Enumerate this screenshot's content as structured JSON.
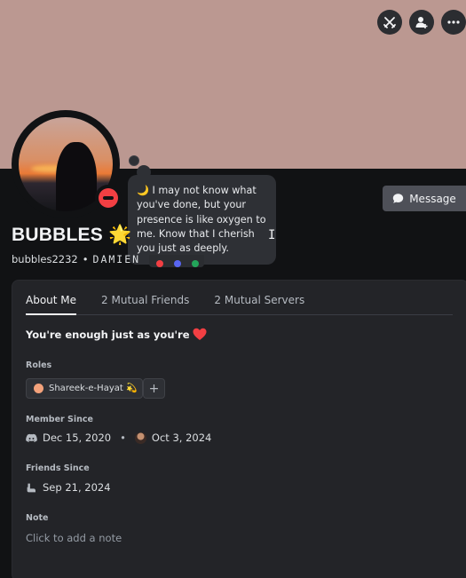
{
  "colors": {
    "banner": "#bb9891",
    "status_dnd": "#f23f43",
    "heart": "#f23f43",
    "role_dot": "#f3a27b"
  },
  "top_actions": {
    "icons": [
      "crossed-swords-icon",
      "person-add-icon",
      "more-options-icon"
    ]
  },
  "status": {
    "icon": "do-not-disturb-icon",
    "custom_status_emoji": "🌙",
    "custom_status_text": "I may not know what you've done, but your presence is like oxygen to me. Know that I cherish you just as deeply."
  },
  "profile": {
    "display_name": "BUBBLES 🌟",
    "username": "bubbles2232",
    "separator": "•",
    "pronouns": "DAMIEN"
  },
  "message_button": {
    "label": "Message",
    "icon": "chat-bubble-icon"
  },
  "tabs": [
    {
      "label": "About Me",
      "active": true
    },
    {
      "label": "2 Mutual Friends",
      "active": false
    },
    {
      "label": "2 Mutual Servers",
      "active": false
    }
  ],
  "about": {
    "text": "You're enough just as you're",
    "emoji": "❤️"
  },
  "roles": {
    "label": "Roles",
    "items": [
      {
        "name": "Shareek-e-Hayat 💫"
      }
    ],
    "add_icon": "plus-icon"
  },
  "member_since": {
    "label": "Member Since",
    "discord_date": "Dec 15, 2020",
    "server_date": "Oct 3, 2024",
    "separator": "•"
  },
  "friends_since": {
    "label": "Friends Since",
    "date": "Sep 21, 2024"
  },
  "note": {
    "label": "Note",
    "placeholder": "Click to add a note"
  }
}
